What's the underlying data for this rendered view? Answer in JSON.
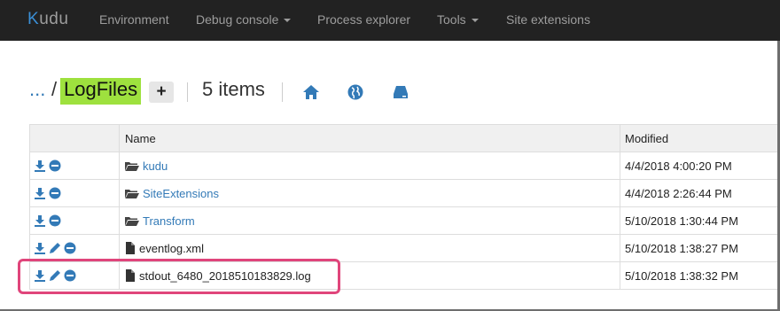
{
  "brand": {
    "prefix": "K",
    "rest": "udu"
  },
  "nav": {
    "environment": "Environment",
    "debug_console": "Debug console",
    "process_explorer": "Process explorer",
    "tools": "Tools",
    "site_extensions": "Site extensions"
  },
  "breadcrumb": {
    "ellipsis": "...",
    "separator": "/",
    "current": "LogFiles",
    "add_label": "+"
  },
  "item_count": "5 items",
  "table": {
    "headers": {
      "name": "Name",
      "modified": "Modified"
    },
    "rows": [
      {
        "name": "kudu",
        "type": "folder",
        "modified": "4/4/2018 4:00:20 PM"
      },
      {
        "name": "SiteExtensions",
        "type": "folder",
        "modified": "4/4/2018 2:26:44 PM"
      },
      {
        "name": "Transform",
        "type": "folder",
        "modified": "5/10/2018 1:30:44 PM"
      },
      {
        "name": "eventlog.xml",
        "type": "file",
        "modified": "5/10/2018 1:38:27 PM"
      },
      {
        "name": "stdout_6480_2018510183829.log",
        "type": "file",
        "modified": "5/10/2018 1:38:32 PM"
      }
    ]
  },
  "colors": {
    "navbar": "#222222",
    "link": "#337ab7",
    "highlight": "#9ee13e",
    "annotation": "#e0457b"
  }
}
